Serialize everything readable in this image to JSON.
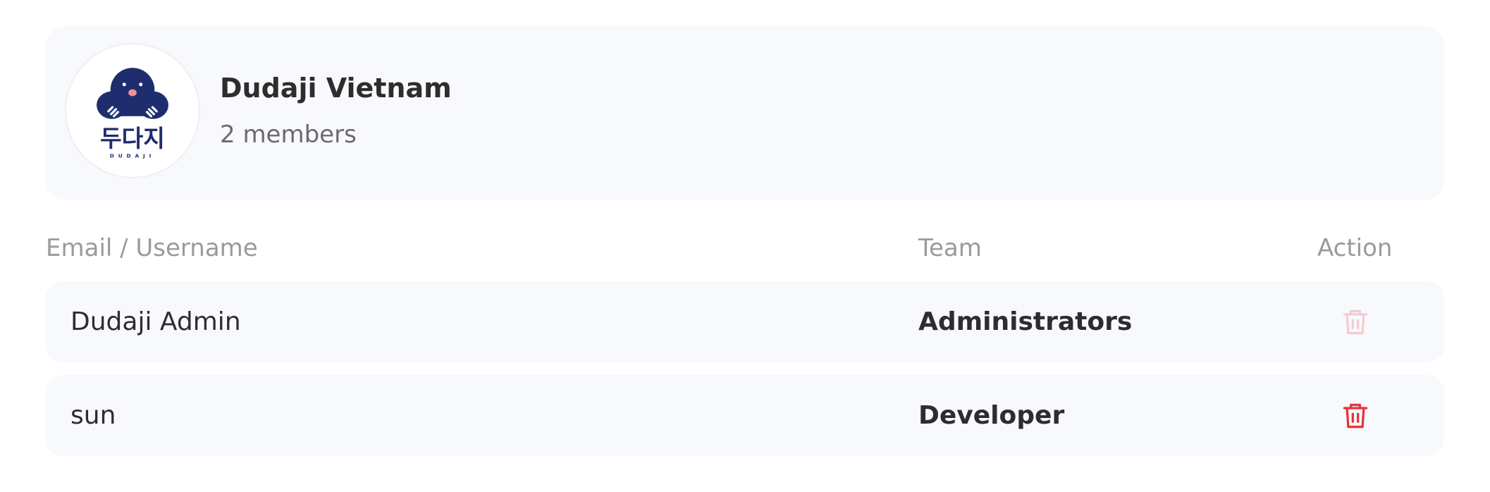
{
  "organization": {
    "name": "Dudaji Vietnam",
    "members": "2 members",
    "logo": {
      "icon": "dudaji-mole-logo",
      "text": "두다지",
      "subtext": "DUDAJI",
      "color": "#1e2d6e"
    }
  },
  "table": {
    "columns": {
      "email": "Email / Username",
      "team": "Team",
      "action": "Action"
    },
    "rows": [
      {
        "name": "Dudaji Admin",
        "team": "Administrators",
        "action_icon": "trash-icon",
        "action_enabled": false
      },
      {
        "name": "sun",
        "team": "Developer",
        "action_icon": "trash-icon",
        "action_enabled": true
      }
    ]
  },
  "colors": {
    "card_bg": "#f8f9fc",
    "delete": "#e8333a",
    "header_text": "#9a9a9a"
  }
}
